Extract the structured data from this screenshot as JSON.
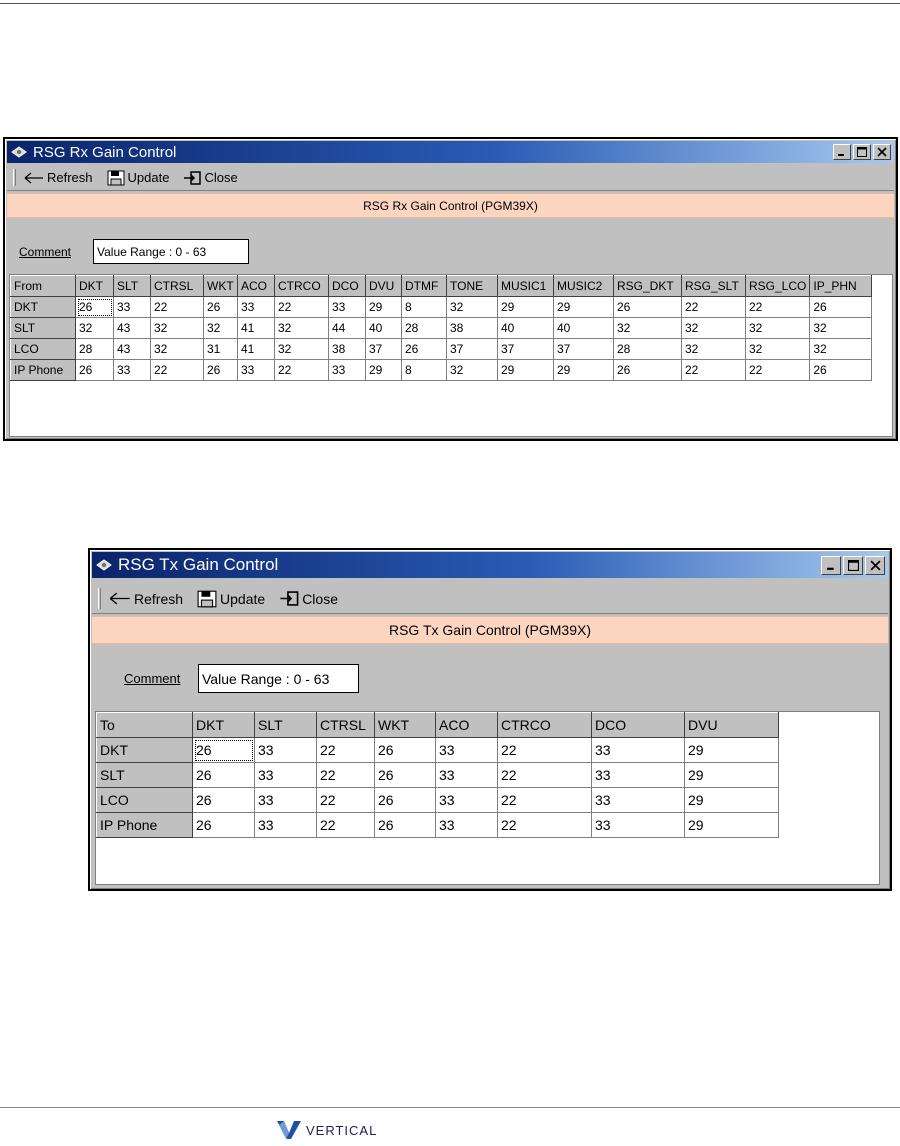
{
  "colors": {
    "title_start": "#0a246a",
    "title_end": "#a6caf0",
    "banner": "#fcd5c0",
    "face": "#c0c0c0",
    "logo": "#1f4fa0"
  },
  "rx": {
    "title": "RSG Rx Gain Control",
    "toolbar": {
      "refresh_label": "Refresh",
      "update_label": "Update",
      "close_label": "Close"
    },
    "banner": "RSG Rx Gain Control (PGM39X)",
    "comment_label": "Comment",
    "comment_value": "Value Range : 0 - 63",
    "columns": [
      "From",
      "DKT",
      "SLT",
      "CTRSL",
      "WKT",
      "ACO",
      "CTRCO",
      "DCO",
      "DVU",
      "DTMF",
      "TONE",
      "MUSIC1",
      "MUSIC2",
      "RSG_DKT",
      "RSG_SLT",
      "RSG_LCO",
      "IP_PHN"
    ],
    "rows": [
      {
        "label": "DKT",
        "values": [
          "26",
          "33",
          "22",
          "26",
          "33",
          "22",
          "33",
          "29",
          "8",
          "32",
          "29",
          "29",
          "26",
          "22",
          "22",
          "26"
        ]
      },
      {
        "label": "SLT",
        "values": [
          "32",
          "43",
          "32",
          "32",
          "41",
          "32",
          "44",
          "40",
          "28",
          "38",
          "40",
          "40",
          "32",
          "32",
          "32",
          "32"
        ]
      },
      {
        "label": "LCO",
        "values": [
          "28",
          "43",
          "32",
          "31",
          "41",
          "32",
          "38",
          "37",
          "26",
          "37",
          "37",
          "37",
          "28",
          "32",
          "32",
          "32"
        ]
      },
      {
        "label": "IP Phone",
        "values": [
          "26",
          "33",
          "22",
          "26",
          "33",
          "22",
          "33",
          "29",
          "8",
          "32",
          "29",
          "29",
          "26",
          "22",
          "22",
          "26"
        ]
      }
    ]
  },
  "tx": {
    "title": "RSG Tx Gain Control",
    "toolbar": {
      "refresh_label": "Refresh",
      "update_label": "Update",
      "close_label": "Close"
    },
    "banner": "RSG Tx Gain Control (PGM39X)",
    "comment_label": "Comment",
    "comment_value": "Value Range : 0 - 63",
    "columns": [
      "To",
      "DKT",
      "SLT",
      "CTRSL",
      "WKT",
      "ACO",
      "CTRCO",
      "DCO",
      "DVU"
    ],
    "rows": [
      {
        "label": "DKT",
        "values": [
          "26",
          "33",
          "22",
          "26",
          "33",
          "22",
          "33",
          "29"
        ]
      },
      {
        "label": "SLT",
        "values": [
          "26",
          "33",
          "22",
          "26",
          "33",
          "22",
          "33",
          "29"
        ]
      },
      {
        "label": "LCO",
        "values": [
          "26",
          "33",
          "22",
          "26",
          "33",
          "22",
          "33",
          "29"
        ]
      },
      {
        "label": "IP Phone",
        "values": [
          "26",
          "33",
          "22",
          "26",
          "33",
          "22",
          "33",
          "29"
        ]
      }
    ]
  },
  "footer": {
    "logo_text": "VERTICAL"
  }
}
